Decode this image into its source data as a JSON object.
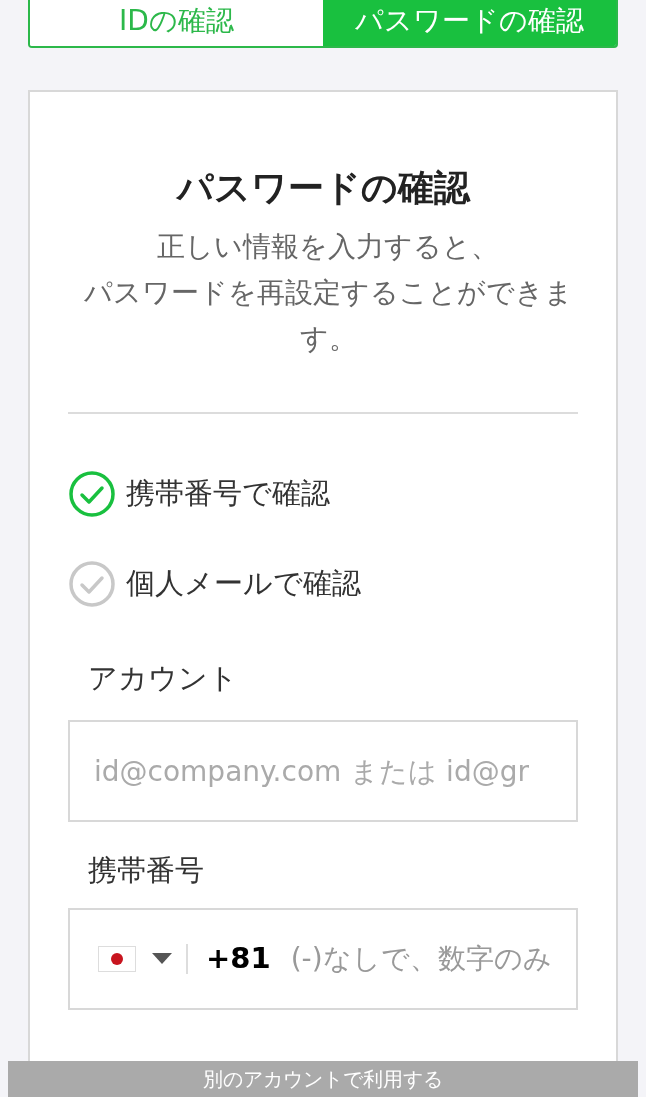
{
  "tabs": [
    {
      "label": "IDの確認",
      "selected": false
    },
    {
      "label": "パスワードの確認",
      "selected": true
    }
  ],
  "card": {
    "title": "パスワードの確認",
    "description_lines": [
      "正しい情報を入力すると、",
      "パスワードを再設定することができます。"
    ],
    "methods": [
      {
        "label": "携帯番号で確認",
        "selected": true
      },
      {
        "label": "個人メールで確認",
        "selected": false
      }
    ],
    "account": {
      "label": "アカウント",
      "placeholder": "id@company.com または id@gr"
    },
    "phone": {
      "label": "携帯番号",
      "country_code": "+81",
      "placeholder": "(-)なしで、数字のみ"
    }
  },
  "bottom_bar": {
    "text": "別のアカウントで利用する"
  }
}
